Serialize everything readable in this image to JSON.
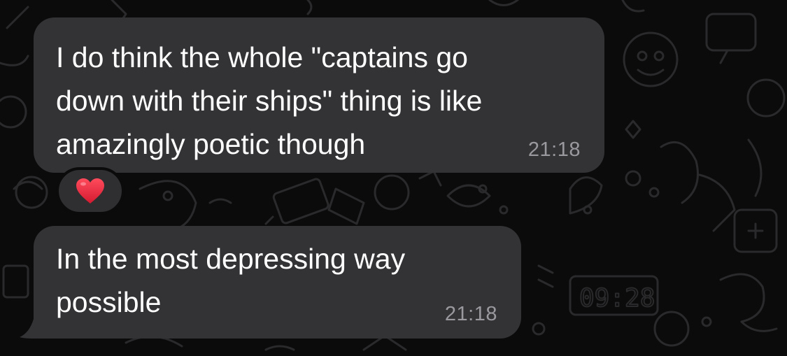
{
  "theme": {
    "background": "#0b0b0b",
    "bubble_color": "#333336",
    "text_color": "#ffffff",
    "timestamp_color": "#9a9a9e",
    "reaction_heart_color": "#e0243b"
  },
  "messages": [
    {
      "text": "I do think the whole \"captains go\ndown with their ships\" thing is like\namazingly poetic though",
      "time": "21:18",
      "reaction": "heart-icon"
    },
    {
      "text": "In the most depressing way\npossible",
      "time": "21:18"
    }
  ]
}
